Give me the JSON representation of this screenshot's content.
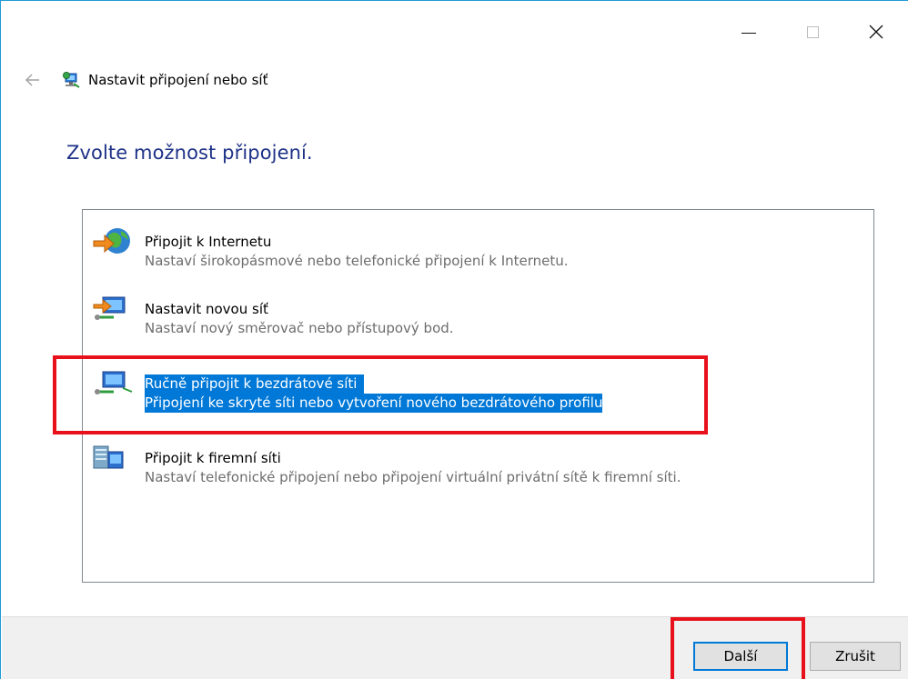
{
  "window": {
    "title": "Nastavit připojení nebo síť"
  },
  "heading": "Zvolte možnost připojení.",
  "options": [
    {
      "title": "Připojit k Internetu",
      "desc": "Nastaví širokopásmové nebo telefonické připojení k Internetu."
    },
    {
      "title": "Nastavit novou síť",
      "desc": "Nastaví nový směrovač nebo přístupový bod."
    },
    {
      "title": "Ručně připojit k bezdrátové síti",
      "desc": "Připojení ke skryté síti nebo vytvoření nového bezdrátového profilu"
    },
    {
      "title": "Připojit k firemní síti",
      "desc": "Nastaví telefonické připojení nebo připojení virtuální privátní sítě k firemní síti."
    }
  ],
  "buttons": {
    "next": "Další",
    "cancel": "Zrušit"
  },
  "colors": {
    "selection": "#0078d7",
    "heading": "#1e3287",
    "highlight": "#e8101a"
  }
}
